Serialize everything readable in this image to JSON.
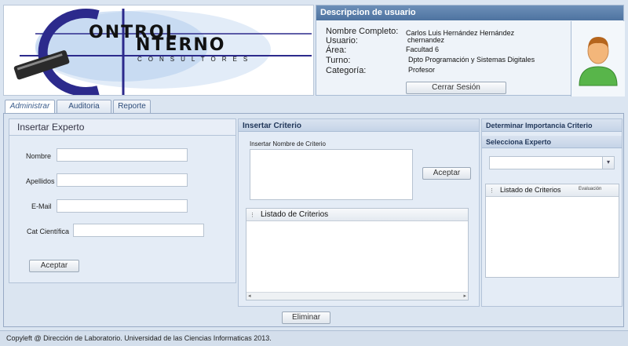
{
  "logo": {
    "line1": "ONTROL",
    "line2": "NTERNO",
    "subtitle": "CONSULTORES"
  },
  "user_panel": {
    "title": "Descripcion de usuario",
    "labels": [
      "Nombre Completo:",
      "Usuario:",
      "Área:",
      "Turno:",
      "Categoría:"
    ],
    "values": [
      "Carlos Luis Hernández Hernández",
      "chernandez",
      "Facultad 6",
      "Dpto Programación y Sistemas Digitales",
      "Profesor"
    ],
    "logout_label": "Cerrar Sesión"
  },
  "tabs": [
    "Administrar",
    "Auditoria",
    "Reporte"
  ],
  "insert_expert": {
    "title": "Insertar Experto",
    "fields": [
      "Nombre",
      "Apellidos",
      "E-Mail",
      "Cat Científica"
    ],
    "submit_label": "Aceptar"
  },
  "insert_criterion": {
    "title": "Insertar Criterio",
    "name_label": "Insertar Nombre de Criterio",
    "submit_label": "Aceptar",
    "list_header": "Listado de Criterios"
  },
  "importance": {
    "title": "Determinar Importancia Criterio",
    "expert_section": "Selecciona Experto",
    "list_header": "Listado de Criterios",
    "list_col2": "Evaluación"
  },
  "delete_label": "Eliminar",
  "footer": "Copyleft @ Dirección de Laboratorio. Universidad de las Ciencias Informaticas 2013.",
  "colors": {
    "accent": "#4e73a0",
    "logo_blue": "#2c2a8c",
    "background": "#dbe5f1"
  }
}
